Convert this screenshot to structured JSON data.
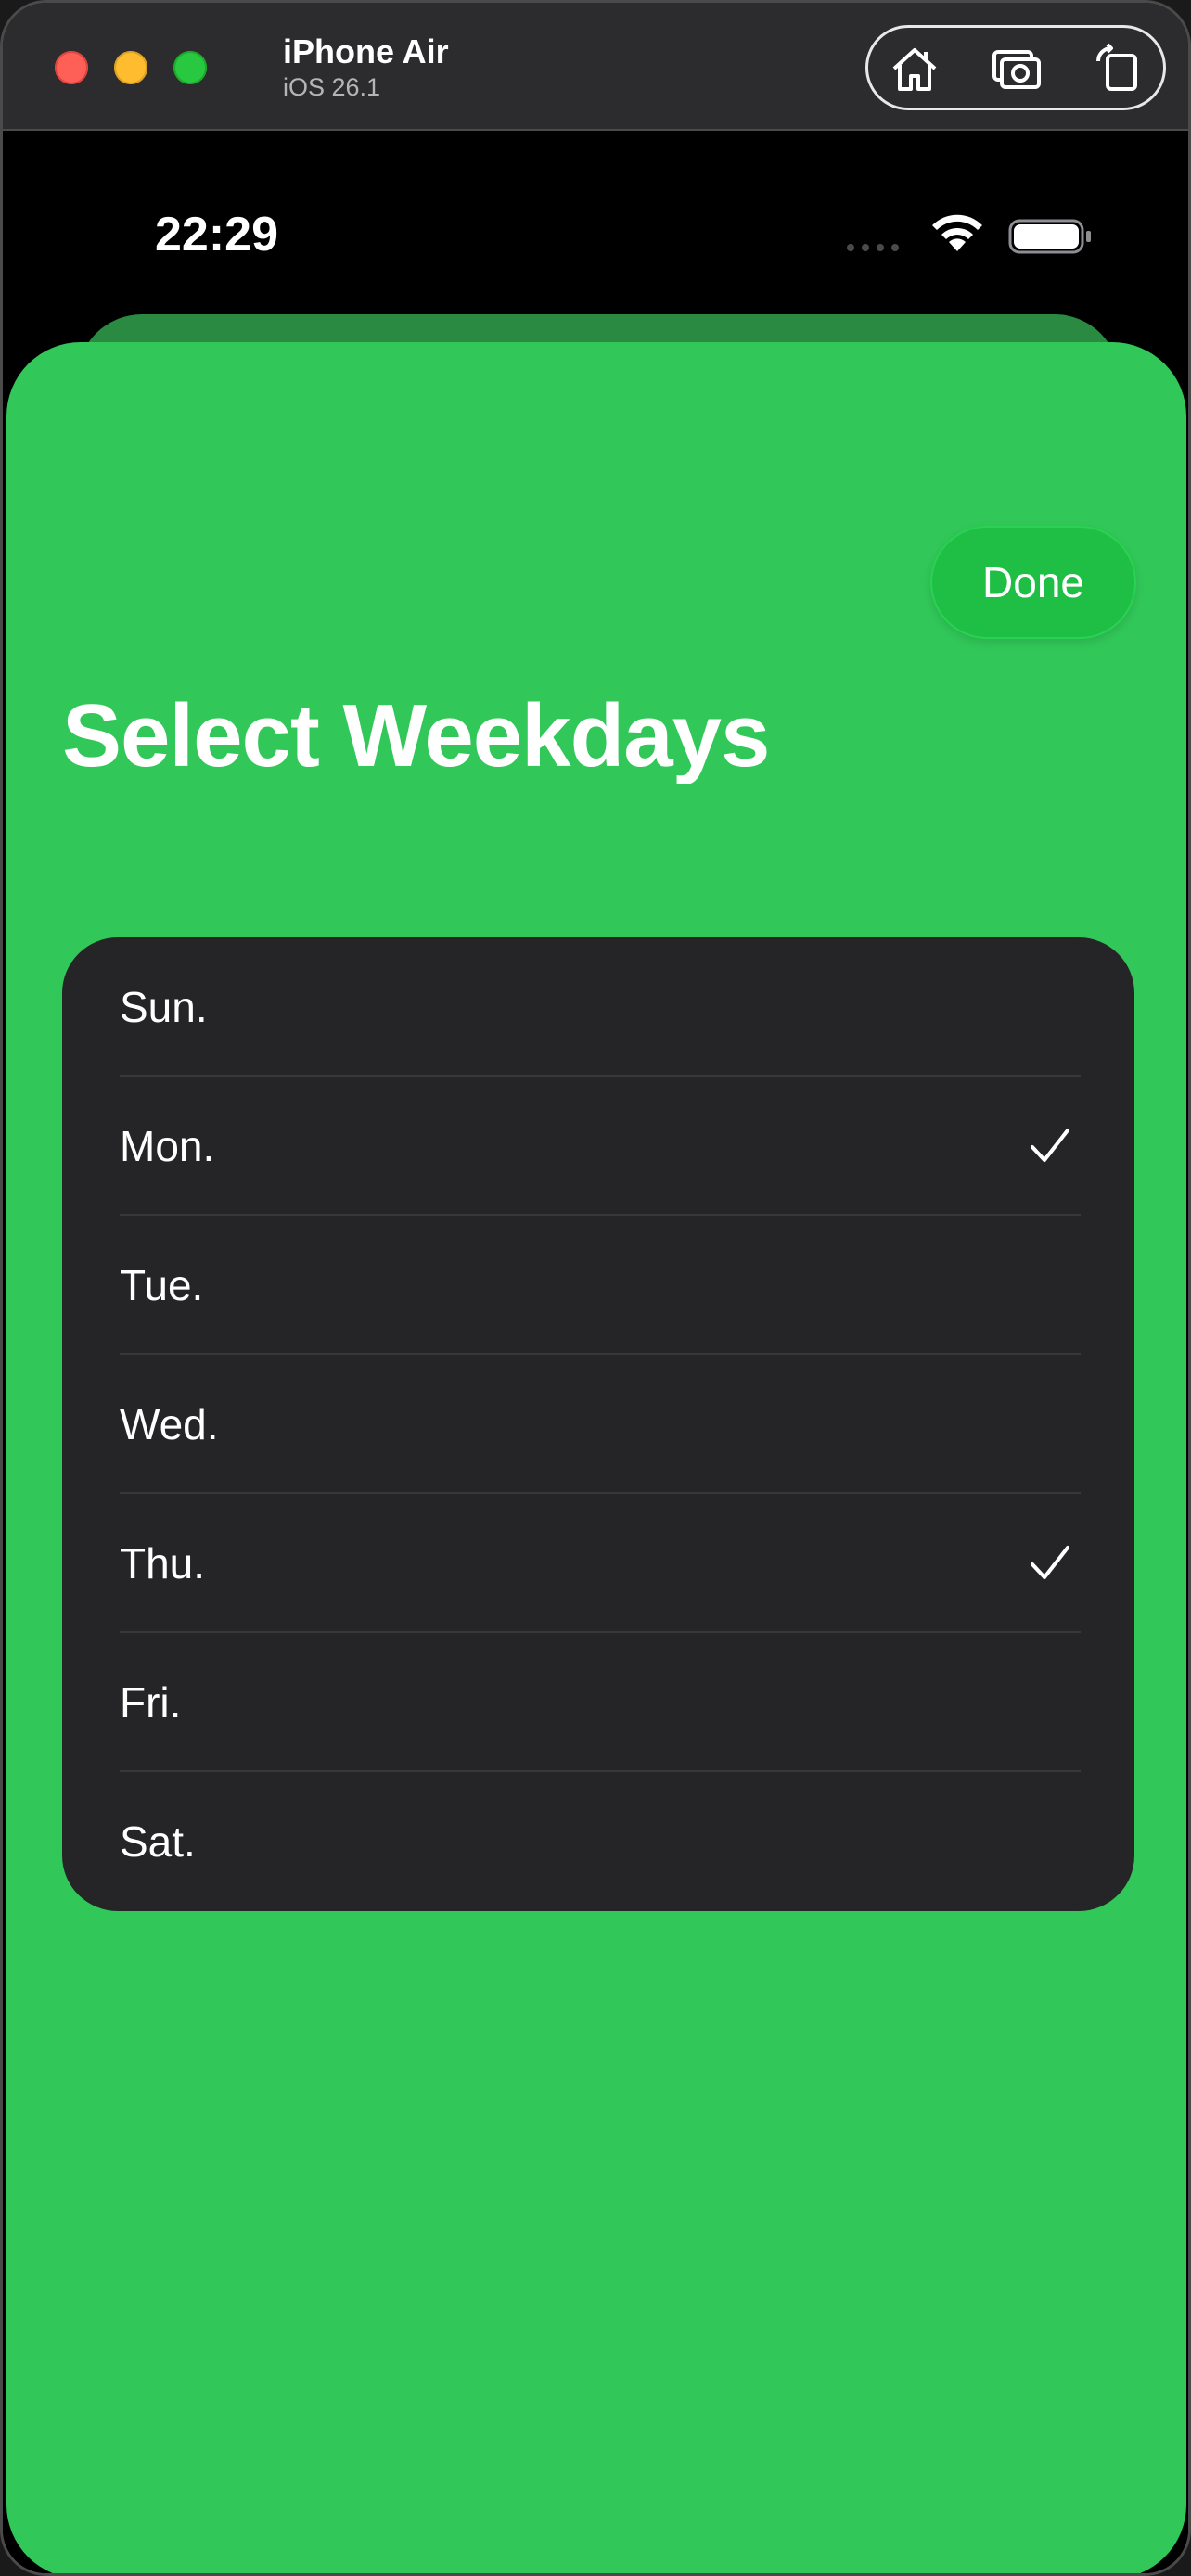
{
  "simulator": {
    "device_name": "iPhone Air",
    "os_version": "iOS 26.1",
    "toolbar_icons": [
      "home-icon",
      "screenshot-icon",
      "rotate-icon"
    ]
  },
  "status_bar": {
    "time": "22:29",
    "icons": [
      "cellular-signal-icon",
      "wifi-icon",
      "battery-icon"
    ]
  },
  "sheet": {
    "done_label": "Done",
    "title": "Select Weekdays",
    "accent_color": "#31c859"
  },
  "weekdays": [
    {
      "label": "Sun.",
      "checked": false
    },
    {
      "label": "Mon.",
      "checked": true
    },
    {
      "label": "Tue.",
      "checked": false
    },
    {
      "label": "Wed.",
      "checked": false
    },
    {
      "label": "Thu.",
      "checked": true
    },
    {
      "label": "Fri.",
      "checked": false
    },
    {
      "label": "Sat.",
      "checked": false
    }
  ]
}
